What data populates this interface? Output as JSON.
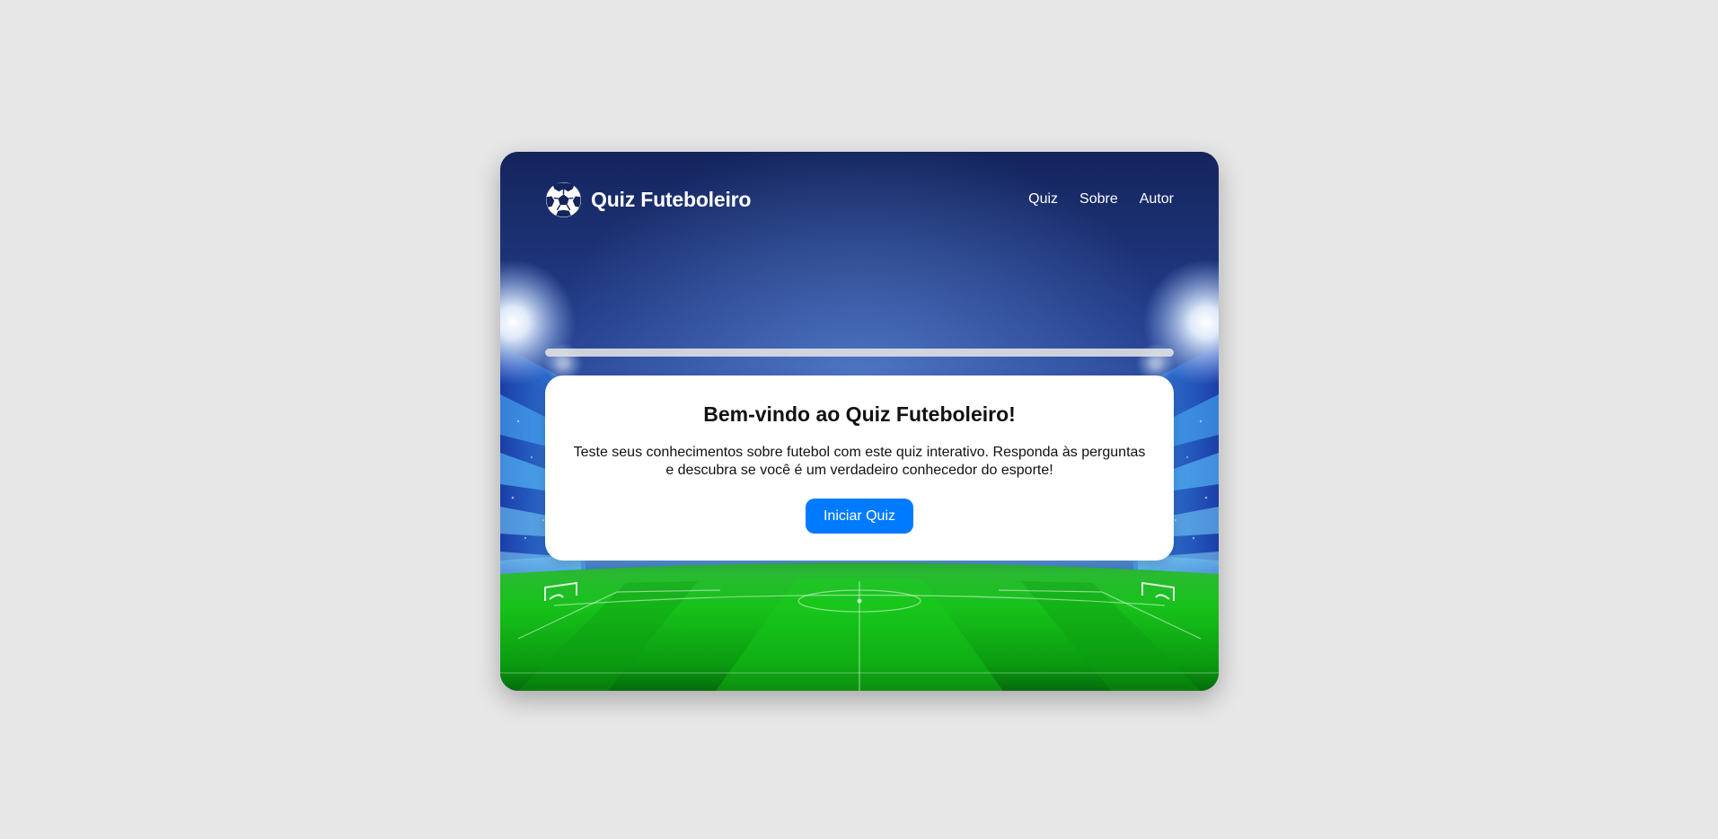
{
  "header": {
    "brand_title": "Quiz Futeboleiro",
    "logo_icon": "soccer-ball-icon",
    "nav": [
      {
        "label": "Quiz"
      },
      {
        "label": "Sobre"
      },
      {
        "label": "Autor"
      }
    ]
  },
  "progress": {
    "value_percent": 0
  },
  "welcome": {
    "title": "Bem-vindo ao Quiz Futeboleiro!",
    "description": "Teste seus conhecimentos sobre futebol com este quiz interativo. Responda às perguntas e descubra se você é um verdadeiro conhecedor do esporte!",
    "start_button": "Iniciar Quiz"
  },
  "colors": {
    "accent": "#007bff",
    "page_background": "#e7e7e7",
    "sky_top": "#14245c",
    "pitch_green": "#17c21a"
  }
}
